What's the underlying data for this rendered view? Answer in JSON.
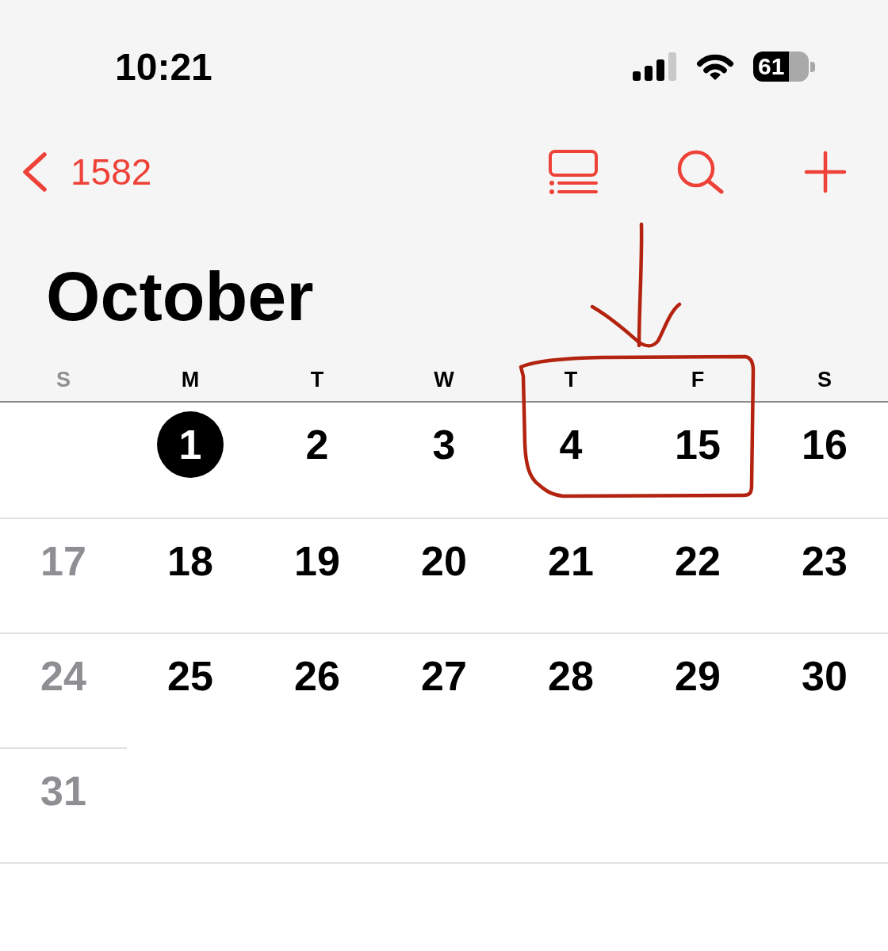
{
  "status_bar": {
    "time": "10:21",
    "battery": "61"
  },
  "nav_bar": {
    "back_label": "1582",
    "actions": [
      {
        "kind": "list"
      },
      {
        "kind": "search"
      },
      {
        "kind": "add"
      }
    ]
  },
  "month": {
    "title": "October"
  },
  "weekdays": [
    {
      "label": "S",
      "dimmed": true
    },
    {
      "label": "M",
      "dimmed": false
    },
    {
      "label": "T",
      "dimmed": false
    },
    {
      "label": "W",
      "dimmed": false
    },
    {
      "label": "T",
      "dimmed": false
    },
    {
      "label": "F",
      "dimmed": false
    },
    {
      "label": "S",
      "dimmed": false
    }
  ],
  "weeks": [
    {
      "days": [
        {
          "day": "1",
          "selected": true,
          "dimmed": false
        },
        {
          "day": "2",
          "selected": false,
          "dimmed": false
        },
        {
          "day": "3",
          "selected": false,
          "dimmed": false
        },
        {
          "day": "4",
          "selected": false,
          "dimmed": false
        },
        {
          "day": "15",
          "selected": false,
          "dimmed": false
        },
        {
          "day": "16",
          "selected": false,
          "dimmed": false
        }
      ]
    },
    {
      "days": [
        {
          "day": "17",
          "selected": false,
          "dimmed": true
        },
        {
          "day": "18",
          "selected": false,
          "dimmed": false
        },
        {
          "day": "19",
          "selected": false,
          "dimmed": false
        },
        {
          "day": "20",
          "selected": false,
          "dimmed": false
        },
        {
          "day": "21",
          "selected": false,
          "dimmed": false
        },
        {
          "day": "22",
          "selected": false,
          "dimmed": false
        },
        {
          "day": "23",
          "selected": false,
          "dimmed": false
        }
      ]
    },
    {
      "days": [
        {
          "day": "24",
          "selected": false,
          "dimmed": true
        },
        {
          "day": "25",
          "selected": false,
          "dimmed": false
        },
        {
          "day": "26",
          "selected": false,
          "dimmed": false
        },
        {
          "day": "27",
          "selected": false,
          "dimmed": false
        },
        {
          "day": "28",
          "selected": false,
          "dimmed": false
        },
        {
          "day": "29",
          "selected": false,
          "dimmed": false
        },
        {
          "day": "30",
          "selected": false,
          "dimmed": false
        }
      ]
    },
    {
      "days": [
        {
          "day": "31",
          "selected": false,
          "dimmed": true
        }
      ]
    }
  ],
  "ink": {
    "arrow": true,
    "outline": true
  }
}
